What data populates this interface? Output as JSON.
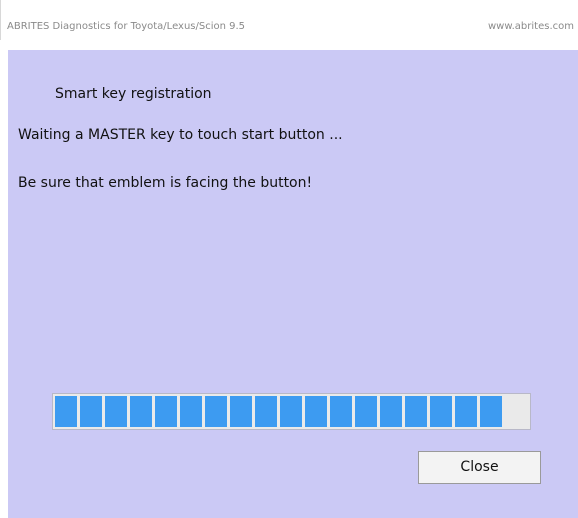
{
  "window": {
    "title": "ABRITES Diagnostics for Toyota/Lexus/Scion 9.5",
    "url": "www.abrites.com"
  },
  "dialog": {
    "section_title": "Smart key registration",
    "message_1": "Waiting a MASTER key to touch start button ...",
    "message_2": "Be sure that emblem is facing the button!",
    "progress": {
      "fraction": 0.94,
      "segments_filled": 18
    },
    "close_label": "Close"
  },
  "colors": {
    "client_bg": "#cbc9f5",
    "progress_fill": "#3d9bf1",
    "progress_track": "#eaeaea"
  }
}
